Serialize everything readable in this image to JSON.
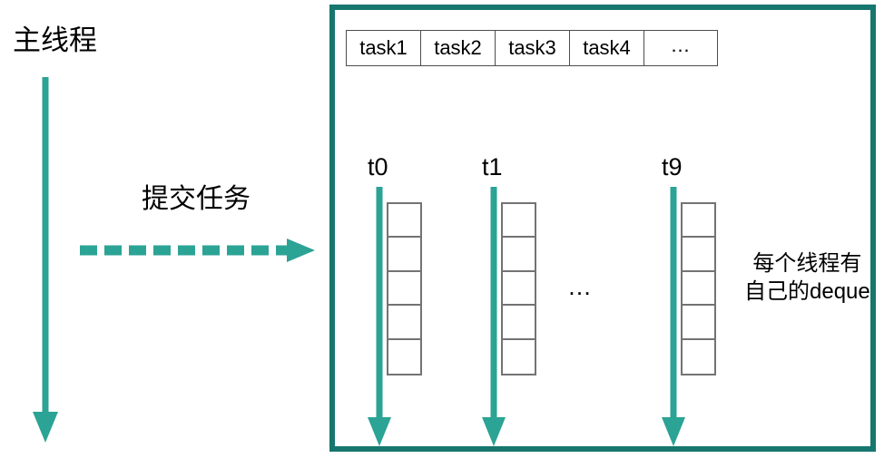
{
  "left": {
    "main_thread_label": "主线程",
    "submit_label": "提交任务",
    "main_arrow_icon": "down-arrow-icon",
    "submit_arrow_icon": "dashed-right-arrow-icon"
  },
  "pool": {
    "task_queue": {
      "cells": [
        "task1",
        "task2",
        "task3",
        "task4",
        "…"
      ]
    },
    "workers": [
      {
        "label": "t0",
        "deque_cells": 5
      },
      {
        "label": "t1",
        "deque_cells": 5
      },
      {
        "label": "t9",
        "deque_cells": 5
      }
    ],
    "workers_ellipsis": "…",
    "deque_note_line1": "每个线程有",
    "deque_note_line2": "自己的deque",
    "deque_note": "每个线程有\n自己的deque"
  },
  "colors": {
    "accent_teal": "#2ba395",
    "frame_teal": "#17766e",
    "box_border": "#4d4d4d",
    "deque_border": "#737373",
    "background": "#ffffff"
  }
}
